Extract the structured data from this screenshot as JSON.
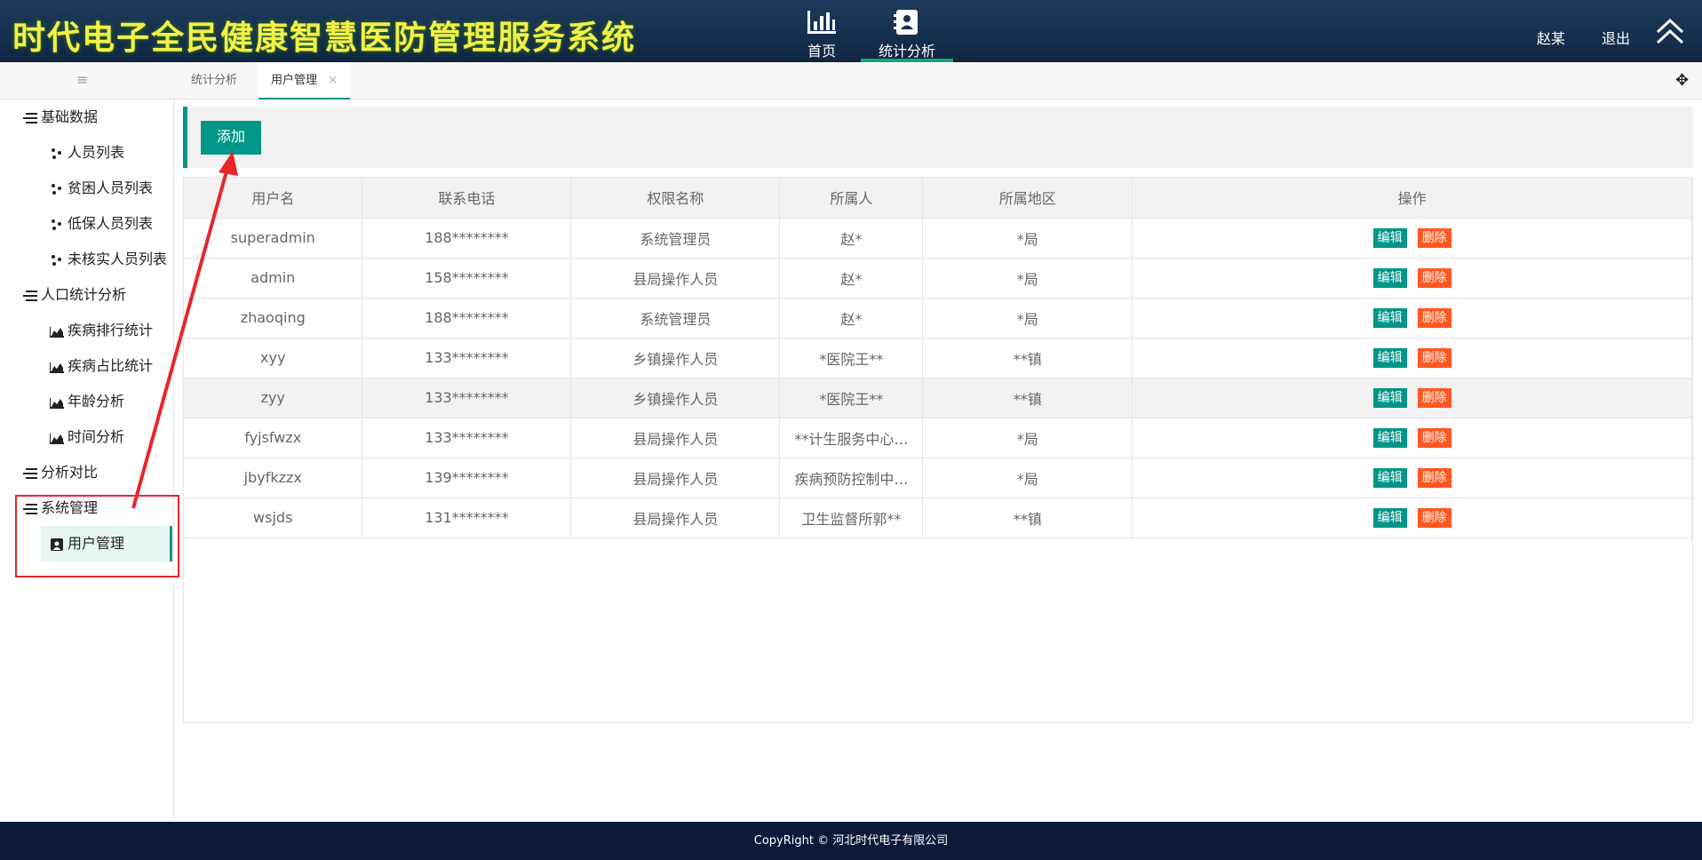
{
  "header": {
    "app_title": "时代电子全民健康智慧医防管理服务系统",
    "nav": [
      {
        "label": "首页",
        "icon": "bar-chart-icon"
      },
      {
        "label": "统计分析",
        "icon": "contacts-book-icon"
      }
    ],
    "user_name": "赵某",
    "logout_label": "退出",
    "collapse_icon": "double-chevron-up-icon"
  },
  "tabs": [
    {
      "label": "统计分析"
    },
    {
      "label": "用户管理",
      "close": "×"
    }
  ],
  "sidebar": {
    "groups": [
      {
        "label": "基础数据",
        "children": [
          "人员列表",
          "贫困人员列表",
          "低保人员列表",
          "未核实人员列表"
        ]
      },
      {
        "label": "人口统计分析",
        "children": [
          "疾病排行统计",
          "疾病占比统计",
          "年龄分析",
          "时间分析"
        ]
      },
      {
        "label": "分析对比",
        "children": []
      },
      {
        "label": "系统管理",
        "children": [
          "用户管理"
        ]
      }
    ]
  },
  "toolbar": {
    "add_label": "添加"
  },
  "table": {
    "headers": [
      "用户名",
      "联系电话",
      "权限名称",
      "所属人",
      "所属地区",
      "操作"
    ],
    "rows": [
      [
        "superadmin",
        "188********",
        "系统管理员",
        "赵*",
        "*局"
      ],
      [
        "admin",
        "158********",
        "县局操作人员",
        "赵*",
        "*局"
      ],
      [
        "zhaoqing",
        "188********",
        "系统管理员",
        "赵*",
        "*局"
      ],
      [
        "xyy",
        "133********",
        "乡镇操作人员",
        "*医院王**",
        "**镇"
      ],
      [
        "zyy",
        "133********",
        "乡镇操作人员",
        "*医院王**",
        "**镇"
      ],
      [
        "fyjsfwzx",
        "133********",
        "县局操作人员",
        "**计生服务中心…",
        "*局"
      ],
      [
        "jbyfkzzx",
        "139********",
        "县局操作人员",
        "疾病预防控制中…",
        "*局"
      ],
      [
        "wsjds",
        "131********",
        "县局操作人员",
        "卫生监督所郭**",
        "**镇"
      ]
    ],
    "edit_label": "编辑",
    "delete_label": "删除"
  },
  "footer": {
    "copyright": "CopyRight © 河北时代电子有限公司"
  },
  "colors": {
    "accent": "#009688",
    "danger": "#ff5722",
    "header_bg": "#15304f",
    "title": "#f3f04a",
    "annotation": "#e8262a"
  }
}
